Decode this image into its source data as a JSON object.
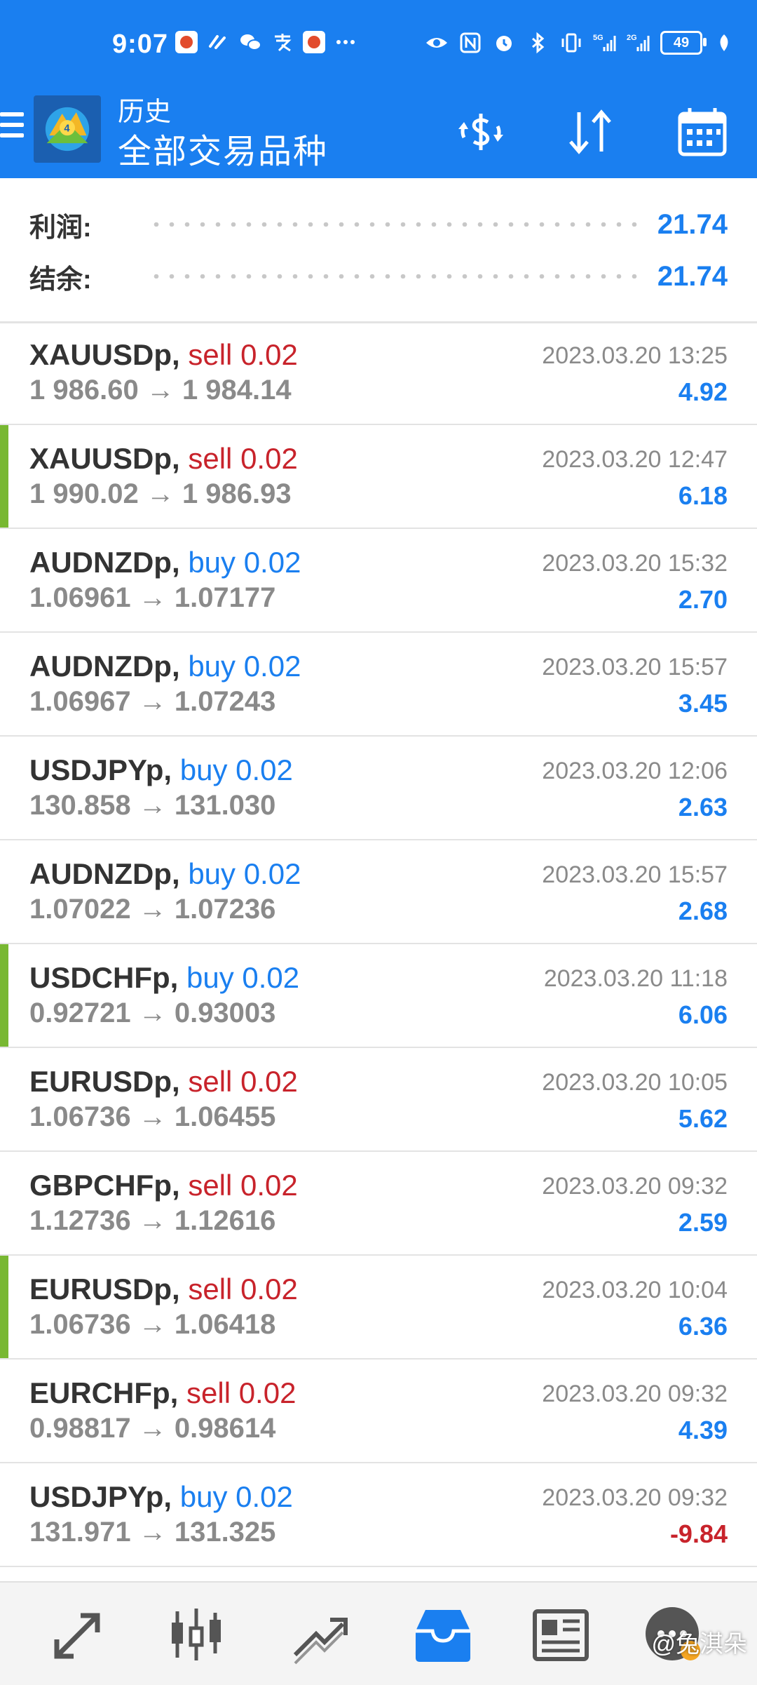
{
  "status_bar": {
    "time": "9:07",
    "battery": "49"
  },
  "header": {
    "title": "历史",
    "subtitle": "全部交易品种"
  },
  "summary": {
    "profit_label": "利润:",
    "profit_value": "21.74",
    "balance_label": "结余:",
    "balance_value": "21.74"
  },
  "trades": [
    {
      "symbol": "XAUUSDp,",
      "side": "sell",
      "lot": "0.02",
      "open": "1 986.60",
      "close": "1 984.14",
      "datetime": "2023.03.20 13:25",
      "profit": "4.92",
      "marked": false
    },
    {
      "symbol": "XAUUSDp,",
      "side": "sell",
      "lot": "0.02",
      "open": "1 990.02",
      "close": "1 986.93",
      "datetime": "2023.03.20 12:47",
      "profit": "6.18",
      "marked": true
    },
    {
      "symbol": "AUDNZDp,",
      "side": "buy",
      "lot": "0.02",
      "open": "1.06961",
      "close": "1.07177",
      "datetime": "2023.03.20 15:32",
      "profit": "2.70",
      "marked": false
    },
    {
      "symbol": "AUDNZDp,",
      "side": "buy",
      "lot": "0.02",
      "open": "1.06967",
      "close": "1.07243",
      "datetime": "2023.03.20 15:57",
      "profit": "3.45",
      "marked": false
    },
    {
      "symbol": "USDJPYp,",
      "side": "buy",
      "lot": "0.02",
      "open": "130.858",
      "close": "131.030",
      "datetime": "2023.03.20 12:06",
      "profit": "2.63",
      "marked": false
    },
    {
      "symbol": "AUDNZDp,",
      "side": "buy",
      "lot": "0.02",
      "open": "1.07022",
      "close": "1.07236",
      "datetime": "2023.03.20 15:57",
      "profit": "2.68",
      "marked": false
    },
    {
      "symbol": "USDCHFp,",
      "side": "buy",
      "lot": "0.02",
      "open": "0.92721",
      "close": "0.93003",
      "datetime": "2023.03.20 11:18",
      "profit": "6.06",
      "marked": true
    },
    {
      "symbol": "EURUSDp,",
      "side": "sell",
      "lot": "0.02",
      "open": "1.06736",
      "close": "1.06455",
      "datetime": "2023.03.20 10:05",
      "profit": "5.62",
      "marked": false
    },
    {
      "symbol": "GBPCHFp,",
      "side": "sell",
      "lot": "0.02",
      "open": "1.12736",
      "close": "1.12616",
      "datetime": "2023.03.20 09:32",
      "profit": "2.59",
      "marked": false
    },
    {
      "symbol": "EURUSDp,",
      "side": "sell",
      "lot": "0.02",
      "open": "1.06736",
      "close": "1.06418",
      "datetime": "2023.03.20 10:04",
      "profit": "6.36",
      "marked": true
    },
    {
      "symbol": "EURCHFp,",
      "side": "sell",
      "lot": "0.02",
      "open": "0.98817",
      "close": "0.98614",
      "datetime": "2023.03.20 09:32",
      "profit": "4.39",
      "marked": false
    },
    {
      "symbol": "USDJPYp,",
      "side": "buy",
      "lot": "0.02",
      "open": "131.971",
      "close": "131.325",
      "datetime": "2023.03.20 09:32",
      "profit": "-9.84",
      "marked": false
    }
  ],
  "bottom_nav": [
    "quotes-icon",
    "chart-icon",
    "trade-icon",
    "history-icon",
    "news-icon",
    "chat-icon"
  ],
  "watermark": "@兔淇朵",
  "colors": {
    "brand": "#1a7ff0",
    "sell": "#c8232b",
    "buy": "#1a7ff0",
    "marker": "#78b832"
  }
}
